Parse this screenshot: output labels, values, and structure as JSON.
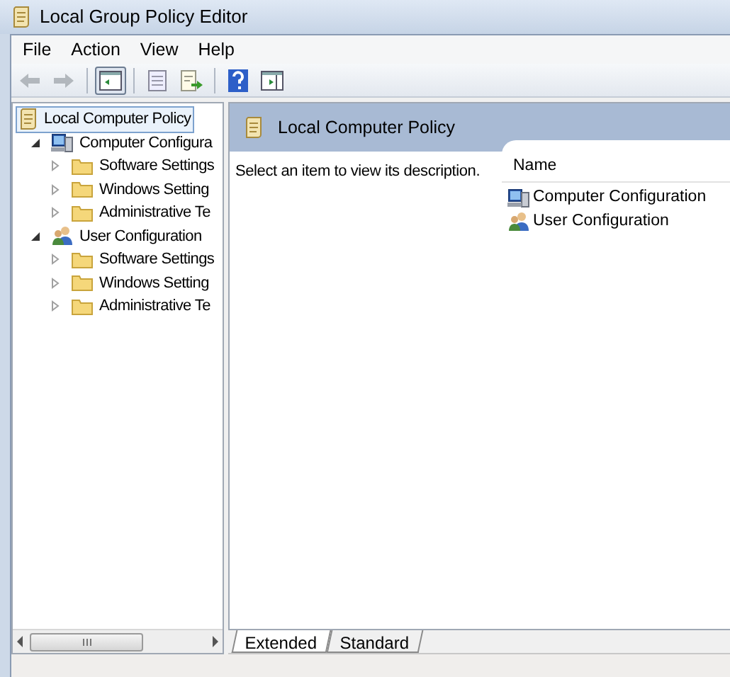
{
  "window": {
    "title": "Local Group Policy Editor"
  },
  "menu": [
    "File",
    "Action",
    "View",
    "Help"
  ],
  "toolbar": [
    {
      "kind": "back",
      "disabled": true,
      "pressed": false
    },
    {
      "kind": "forward",
      "disabled": true,
      "pressed": false
    },
    {
      "kind": "separator"
    },
    {
      "kind": "console-tree",
      "disabled": false,
      "pressed": true
    },
    {
      "kind": "separator"
    },
    {
      "kind": "properties",
      "disabled": false,
      "pressed": false
    },
    {
      "kind": "export",
      "disabled": false,
      "pressed": false
    },
    {
      "kind": "separator"
    },
    {
      "kind": "help",
      "disabled": false,
      "pressed": false
    },
    {
      "kind": "action-pane",
      "disabled": false,
      "pressed": false
    }
  ],
  "tree": [
    {
      "label": "Local Computer Policy",
      "kind": "policy",
      "selected": true,
      "children": [
        {
          "label": "Computer Configura",
          "kind": "computer",
          "selected": false,
          "expanded": true,
          "children": [
            {
              "label": "Software Settings",
              "kind": "folder",
              "selected": false,
              "expanded": false
            },
            {
              "label": "Windows Setting",
              "kind": "folder",
              "selected": false,
              "expanded": false
            },
            {
              "label": "Administrative Te",
              "kind": "folder",
              "selected": false,
              "expanded": false
            }
          ]
        },
        {
          "label": "User Configuration",
          "kind": "user",
          "selected": false,
          "expanded": true,
          "children": [
            {
              "label": "Software Settings",
              "kind": "folder",
              "selected": false,
              "expanded": false
            },
            {
              "label": "Windows Setting",
              "kind": "folder",
              "selected": false,
              "expanded": false
            },
            {
              "label": "Administrative Te",
              "kind": "folder",
              "selected": false,
              "expanded": false
            }
          ]
        }
      ]
    }
  ],
  "details": {
    "title": "Local Computer Policy",
    "description": "Select an item to view its description.",
    "column": "Name",
    "items": [
      {
        "label": "Computer Configuration",
        "kind": "computer"
      },
      {
        "label": "User Configuration",
        "kind": "user"
      }
    ]
  },
  "tabs": [
    {
      "label": "Extended",
      "selected": true
    },
    {
      "label": "Standard",
      "selected": false
    }
  ]
}
